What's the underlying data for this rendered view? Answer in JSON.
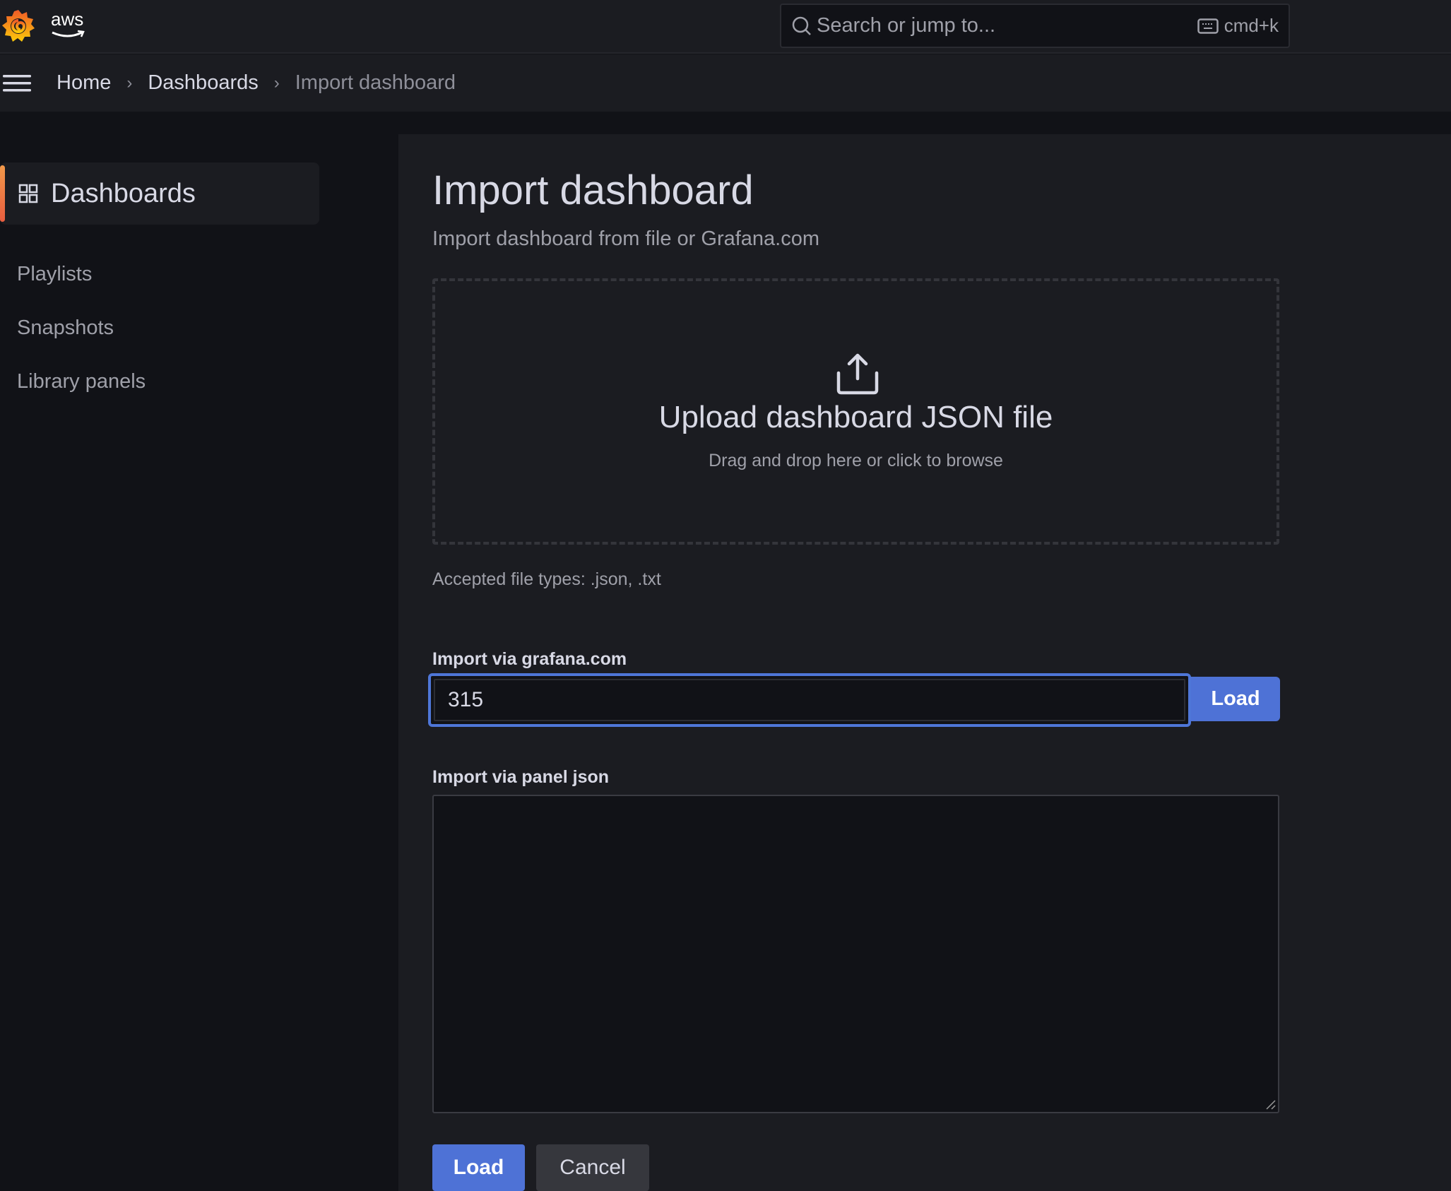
{
  "topbar": {
    "logo_icon": "grafana-logo-icon",
    "org_logo_text": "aws",
    "search": {
      "placeholder": "Search or jump to...",
      "shortcut_icon": "keyboard-icon",
      "shortcut": "cmd+k"
    }
  },
  "breadcrumb": {
    "menu_icon": "hamburger-menu-icon",
    "items": [
      {
        "label": "Home"
      },
      {
        "label": "Dashboards"
      },
      {
        "label": "Import dashboard"
      }
    ],
    "separator": "›"
  },
  "sidebar": {
    "section": {
      "label": "Dashboards",
      "icon": "apps-grid-icon",
      "accent": "#f2994a"
    },
    "items": [
      {
        "label": "Playlists"
      },
      {
        "label": "Snapshots"
      },
      {
        "label": "Library panels"
      }
    ]
  },
  "main": {
    "title": "Import dashboard",
    "subtitle": "Import dashboard from file or Grafana.com",
    "dropzone": {
      "icon": "upload-icon",
      "title": "Upload dashboard JSON file",
      "subtitle": "Drag and drop here or click to browse"
    },
    "accepted_types": "Accepted file types: .json, .txt",
    "grafana_com": {
      "label": "Import via grafana.com",
      "value": "315",
      "load_label": "Load"
    },
    "panel_json": {
      "label": "Import via panel json",
      "value": ""
    },
    "actions": {
      "load_label": "Load",
      "cancel_label": "Cancel"
    }
  },
  "colors": {
    "primary": "#4e72d6",
    "focus_border": "#4e76d8",
    "background": "#111217",
    "panel": "#1b1c21"
  }
}
